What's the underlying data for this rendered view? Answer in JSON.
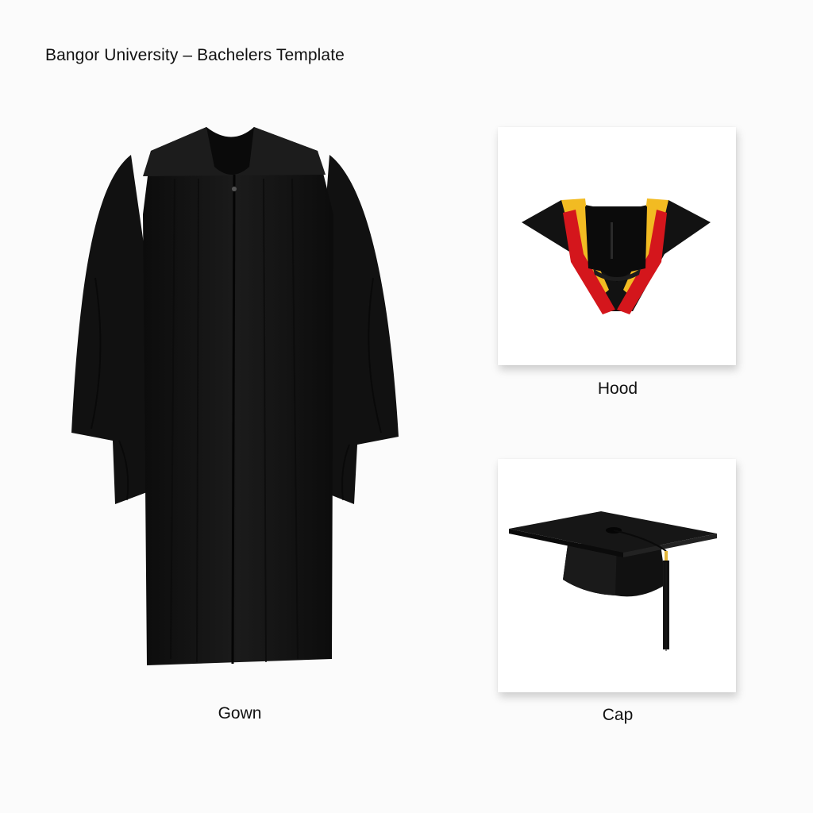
{
  "page": {
    "title": "Bangor University – Bachelers Template"
  },
  "items": [
    {
      "caption": "Gown"
    },
    {
      "caption": "Hood"
    },
    {
      "caption": "Cap"
    }
  ],
  "colors": {
    "background": "#fbfbfb",
    "garment_black": "#141414",
    "hood_red": "#d4161c",
    "hood_gold": "#f2bb22",
    "tassel_gold": "#e2b53a"
  },
  "icons": [
    "gown-image",
    "hood-image",
    "cap-image"
  ]
}
